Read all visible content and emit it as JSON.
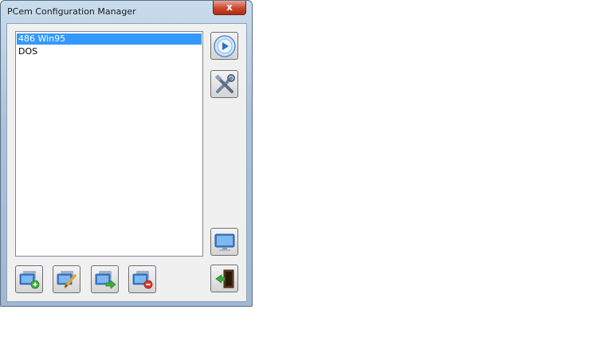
{
  "window": {
    "title": "PCem Configuration Manager",
    "close_label": "x"
  },
  "configs": {
    "items": [
      {
        "label": "486 Win95",
        "selected": true
      },
      {
        "label": "DOS",
        "selected": false
      }
    ]
  },
  "buttons": {
    "run": "play-icon",
    "settings": "tools-icon",
    "display": "monitor-icon",
    "exit": "exit-door-icon",
    "new": "new-config-icon",
    "edit": "edit-config-icon",
    "copy": "copy-config-icon",
    "delete": "delete-config-icon"
  },
  "colors": {
    "selection": "#3399ff",
    "close_button": "#c8472f"
  }
}
